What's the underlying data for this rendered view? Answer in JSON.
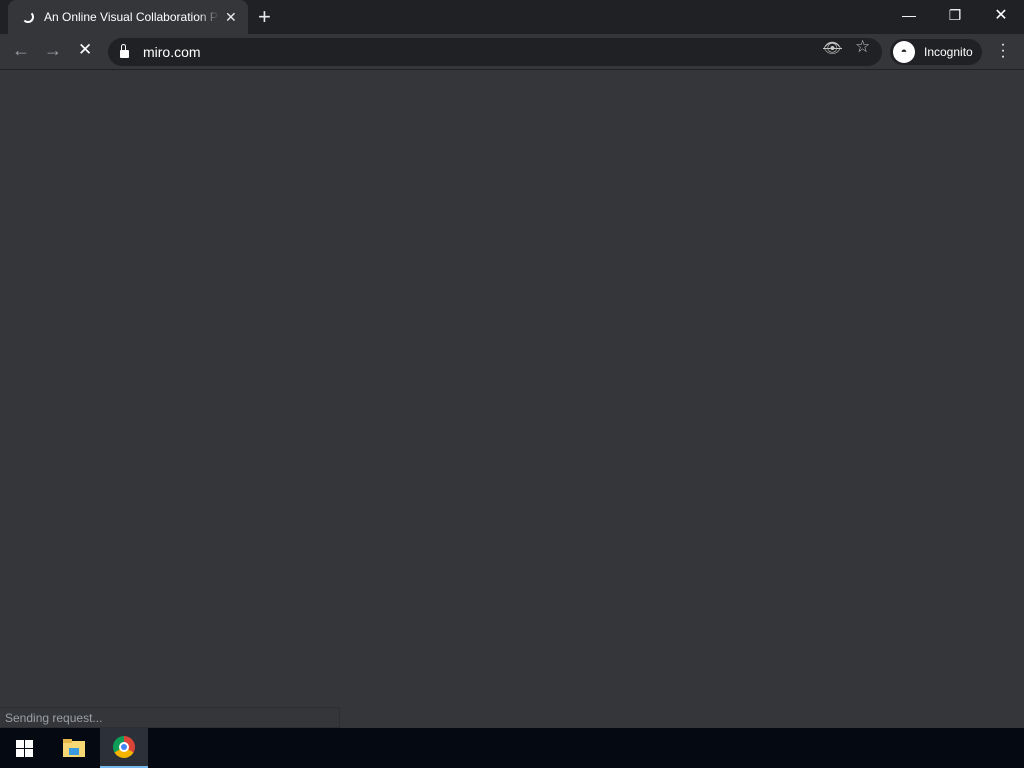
{
  "tab": {
    "title": "An Online Visual Collaboration Platform",
    "close": "✕"
  },
  "new_tab": "+",
  "window": {
    "minimize": "—",
    "restore": "❐",
    "close": "✕"
  },
  "toolbar": {
    "back": "←",
    "forward": "→",
    "stop": "✕",
    "url": "miro.com",
    "tracking_icon": "eye-off",
    "bookmark": "☆",
    "incognito_label": "Incognito",
    "menu": "⋮"
  },
  "status": "Sending request...",
  "taskbar": {
    "items": [
      "start",
      "file-explorer",
      "chrome"
    ],
    "active_color": "#76b9ed"
  }
}
